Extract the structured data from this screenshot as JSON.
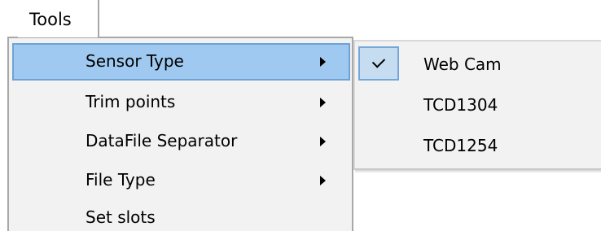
{
  "menubar": {
    "tools_label": "Tools"
  },
  "tools_menu": {
    "items": [
      {
        "label": "Sensor Type",
        "has_submenu": true,
        "highlighted": true
      },
      {
        "label": "Trim points",
        "has_submenu": true
      },
      {
        "label": "DataFile Separator",
        "has_submenu": true
      },
      {
        "label": "File Type",
        "has_submenu": true
      },
      {
        "label": "Set slots",
        "has_submenu": false
      }
    ]
  },
  "sensor_type_submenu": {
    "items": [
      {
        "label": "Web Cam",
        "checked": true
      },
      {
        "label": "TCD1304",
        "checked": false
      },
      {
        "label": "TCD1254",
        "checked": false
      }
    ]
  },
  "colors": {
    "highlight_fill": "#9fc9f0",
    "highlight_border": "#6fa2d3",
    "menu_background": "#f2f2f2",
    "check_fill": "#c6dcf1"
  }
}
